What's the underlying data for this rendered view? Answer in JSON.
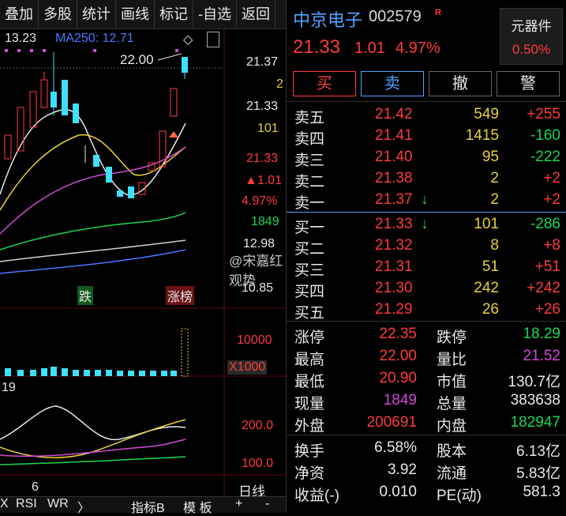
{
  "toolbar": {
    "items": [
      "叠加",
      "多股",
      "统计",
      "画线",
      "标记",
      "-自选",
      "返回"
    ]
  },
  "chart": {
    "ma_labels": {
      "ma_value": "13.23",
      "ma250": "MA250: 12.71"
    },
    "peak_label": "22.00",
    "price_axis": [
      "21.37",
      "2",
      "21.33",
      "101",
      "21.33",
      "▲1.01",
      "4.97%",
      "1849",
      "12.98",
      "10.85"
    ],
    "badges": {
      "die": "跌",
      "zhangbang": "涨榜"
    },
    "volume_axis": {
      "top": "10000",
      "unit": "X1000"
    },
    "indicator_axis": {
      "top": "200.0",
      "bottom": "100.0",
      "left_val": "19"
    },
    "date_label": "6",
    "period": "日线",
    "bottom_tabs": [
      "X",
      "RSI",
      "WR",
      "〉",
      "指标B",
      "模 板",
      "+",
      "-"
    ],
    "watermark": "@宋嘉红观势"
  },
  "stock": {
    "name": "中京电子",
    "code": "002579",
    "badge": "R",
    "price": "21.33",
    "change": "1.01",
    "change_pct": "4.97%",
    "sector": {
      "name": "元器件",
      "pct": "0.50%"
    }
  },
  "actions": {
    "buy": "买",
    "sell": "卖",
    "cancel": "撤",
    "alert": "警"
  },
  "asks": [
    {
      "label": "卖五",
      "price": "21.42",
      "vol": "549",
      "delta": "+255"
    },
    {
      "label": "卖四",
      "price": "21.41",
      "vol": "1415",
      "delta": "-160"
    },
    {
      "label": "卖三",
      "price": "21.40",
      "vol": "95",
      "delta": "-222"
    },
    {
      "label": "卖二",
      "price": "21.38",
      "vol": "2",
      "delta": "+2"
    },
    {
      "label": "卖一",
      "price": "21.37",
      "vol": "2",
      "delta": "+2"
    }
  ],
  "bids": [
    {
      "label": "买一",
      "price": "21.33",
      "vol": "101",
      "delta": "-286"
    },
    {
      "label": "买二",
      "price": "21.32",
      "vol": "8",
      "delta": "+8"
    },
    {
      "label": "买三",
      "price": "21.31",
      "vol": "51",
      "delta": "+51"
    },
    {
      "label": "买四",
      "price": "21.30",
      "vol": "242",
      "delta": "+242"
    },
    {
      "label": "买五",
      "price": "21.29",
      "vol": "26",
      "delta": "+26"
    }
  ],
  "stats": [
    {
      "l1": "涨停",
      "v1": "22.35",
      "l2": "跌停",
      "v2": "18.29"
    },
    {
      "l1": "最高",
      "v1": "22.00",
      "l2": "量比",
      "v2": "21.52"
    },
    {
      "l1": "最低",
      "v1": "20.90",
      "l2": "市值",
      "v2": "130.7亿"
    },
    {
      "l1": "现量",
      "v1": "1849",
      "l2": "总量",
      "v2": "383638"
    },
    {
      "l1": "外盘",
      "v1": "200691",
      "l2": "内盘",
      "v2": "182947"
    }
  ],
  "fundamentals": [
    {
      "l1": "换手",
      "v1": "6.58%",
      "l2": "股本",
      "v2": "6.13亿"
    },
    {
      "l1": "净资",
      "v1": "3.92",
      "l2": "流通",
      "v2": "5.83亿"
    },
    {
      "l1": "收益(-)",
      "v1": "0.010",
      "l2": "PE(动)",
      "v2": "581.3"
    }
  ]
}
